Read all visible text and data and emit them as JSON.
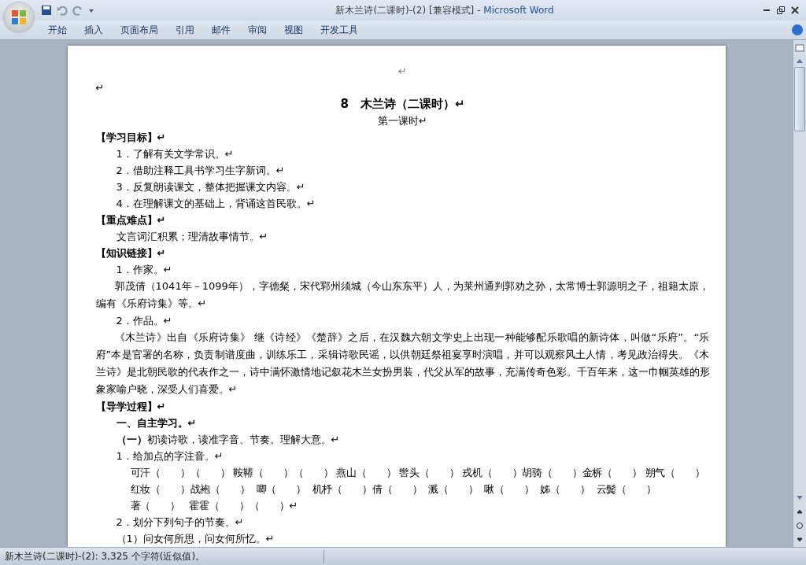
{
  "window": {
    "title": "新木兰诗(二课时)-(2) [兼容模式]",
    "separator": "-",
    "app": "Microsoft Word"
  },
  "ribbon_tabs": [
    "开始",
    "插入",
    "页面布局",
    "引用",
    "邮件",
    "审阅",
    "视图",
    "开发工具"
  ],
  "document": {
    "lines": [
      {
        "kind": "header",
        "text": "↵"
      },
      {
        "kind": "plain",
        "text": "↵"
      },
      {
        "kind": "title",
        "text": "8　木兰诗（二课时）↵"
      },
      {
        "kind": "subtitle",
        "text": "第一课时↵"
      },
      {
        "kind": "heading",
        "text": "【学习目标】↵"
      },
      {
        "kind": "item",
        "text": "1．了解有关文学常识。↵"
      },
      {
        "kind": "item",
        "text": "2．借助注释工具书学习生字新词。↵"
      },
      {
        "kind": "item",
        "text": "3．反复朗读课文，整体把握课文内容。↵"
      },
      {
        "kind": "item",
        "text": "4．在理解课文的基础上，背诵这首民歌。↵"
      },
      {
        "kind": "heading",
        "text": "【重点难点】↵"
      },
      {
        "kind": "item",
        "text": "文言词汇积累；理清故事情节。↵"
      },
      {
        "kind": "heading",
        "text": "【知识链接】↵"
      },
      {
        "kind": "item",
        "text": "1．作家。↵"
      },
      {
        "kind": "para",
        "text": "郭茂倩（1041年－1099年），字德粲，宋代郓州须城（今山东东平）人，为莱州通判郭劝之孙，太常博士郭源明之子，祖籍太原，编有《乐府诗集》等。↵"
      },
      {
        "kind": "item",
        "text": "2．作品。↵"
      },
      {
        "kind": "para",
        "text": "《木兰诗》出自《乐府诗集》 继《诗经》《楚辞》之后，在汉魏六朝文学史上出现一种能够配乐歌唱的新诗体，叫做“乐府”。“乐府”本是官署的名称，负责制谱度曲，训练乐工，采辑诗歌民谣，以供朝廷祭祖宴享时演唱，并可以观察风土人情，考见政治得失。《木兰诗》是北朝民歌的代表作之一，诗中满怀激情地记叙花木兰女扮男装，代父从军的故事，充满传奇色彩。千百年来，这一巾帼英雄的形象家喻户晓，深受人们喜爱。↵"
      },
      {
        "kind": "heading",
        "text": "【导学过程】↵"
      },
      {
        "kind": "section",
        "text": "一、自主学习。↵"
      },
      {
        "kind": "item",
        "text": "**（一）**初读诗歌，读准字音、节奏。理解大意。↵"
      },
      {
        "kind": "item",
        "text": "1．给加点的字注音。↵"
      },
      {
        "kind": "exercise",
        "text": "可汗（　　）（　　） 鞍鞯（　　）（　　） 燕山（　　） 辔头（　　） 戎机（　　）胡骑（　　）金柝（　　） 朔气（　　）"
      },
      {
        "kind": "exercise",
        "text": "红妆（　　）战袍（　　）  唧（　　）  机杼（　　）倩（　　）  溅（　　）  啾（　　）  姊（　　）  云鬓（　　）"
      },
      {
        "kind": "exercise",
        "text": "著（　　）   霍霍（　　）（　　）↵"
      },
      {
        "kind": "item",
        "text": "2．划分下列句子的节奏。↵"
      },
      {
        "kind": "item",
        "text": "（1）问女何所思，问女何所忆。↵"
      }
    ]
  },
  "status_bar": {
    "text": "新木兰诗(二课时)-(2): 3,325 个字符(近似值)。"
  }
}
